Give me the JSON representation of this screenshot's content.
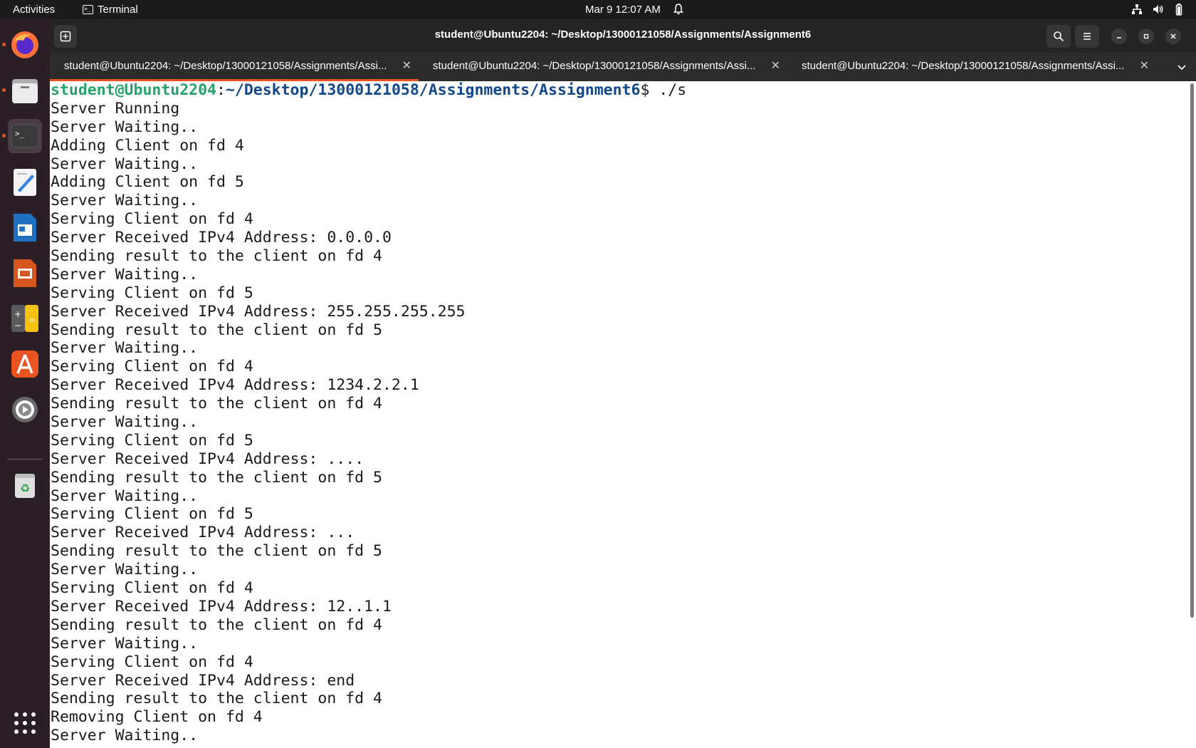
{
  "topbar": {
    "activities": "Activities",
    "app_name": "Terminal",
    "clock": "Mar 9  12:07 AM"
  },
  "dock": {
    "apps": [
      "firefox",
      "files",
      "terminal",
      "text-editor",
      "writer",
      "impress",
      "calculator",
      "app-center",
      "settings",
      "trash",
      "show-apps"
    ]
  },
  "window": {
    "title": "student@Ubuntu2204: ~/Desktop/13000121058/Assignments/Assignment6",
    "tabs": [
      {
        "label": "student@Ubuntu2204: ~/Desktop/13000121058/Assignments/Assi..."
      },
      {
        "label": "student@Ubuntu2204: ~/Desktop/13000121058/Assignments/Assi..."
      },
      {
        "label": "student@Ubuntu2204: ~/Desktop/13000121058/Assignments/Assi..."
      }
    ]
  },
  "terminal": {
    "prompt_user": "student@Ubuntu2204",
    "prompt_sep": ":",
    "prompt_path": "~/Desktop/13000121058/Assignments/Assignment6",
    "prompt_cmd": "$ ./s",
    "lines": [
      "Server Running",
      "Server Waiting..",
      "Adding Client on fd 4",
      "Server Waiting..",
      "Adding Client on fd 5",
      "Server Waiting..",
      "Serving Client on fd 4",
      "Server Received IPv4 Address: 0.0.0.0",
      "Sending result to the client on fd 4",
      "Server Waiting..",
      "Serving Client on fd 5",
      "Server Received IPv4 Address: 255.255.255.255",
      "Sending result to the client on fd 5",
      "Server Waiting..",
      "Serving Client on fd 4",
      "Server Received IPv4 Address: 1234.2.2.1",
      "Sending result to the client on fd 4",
      "Server Waiting..",
      "Serving Client on fd 5",
      "Server Received IPv4 Address: ....",
      "Sending result to the client on fd 5",
      "Server Waiting..",
      "Serving Client on fd 5",
      "Server Received IPv4 Address: ...",
      "Sending result to the client on fd 5",
      "Server Waiting..",
      "Serving Client on fd 4",
      "Server Received IPv4 Address: 12..1.1",
      "Sending result to the client on fd 4",
      "Server Waiting..",
      "Serving Client on fd 4",
      "Server Received IPv4 Address: end",
      "Sending result to the client on fd 4",
      "Removing Client on fd 4",
      "Server Waiting.."
    ]
  }
}
